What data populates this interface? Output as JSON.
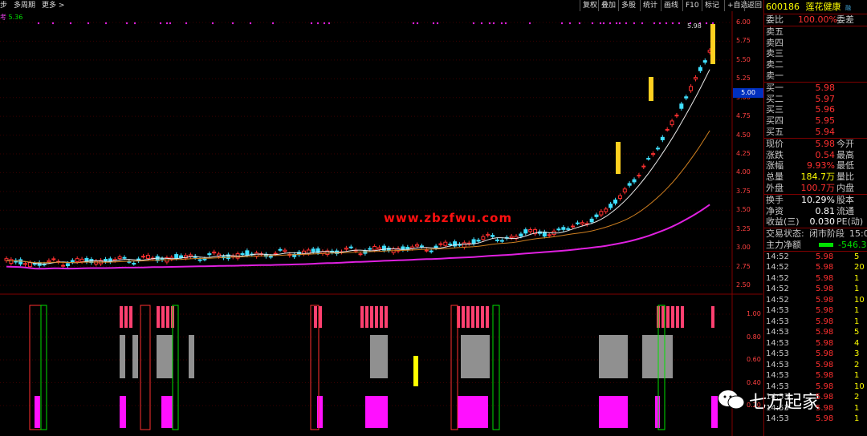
{
  "toolbar": {
    "left_items": [
      "步",
      "多周期",
      "更多 >"
    ],
    "buttons": [
      "复权",
      "叠加",
      "多股",
      "统计",
      "画线",
      "F10",
      "标记",
      "+自选",
      "返回"
    ]
  },
  "indicator": {
    "name": "考",
    "value": "5.36"
  },
  "price_axis": [
    "6.00",
    "5.75",
    "5.50",
    "5.25",
    "5.00",
    "4.75",
    "4.50",
    "4.25",
    "4.00",
    "3.75",
    "3.50",
    "3.25",
    "3.00",
    "2.75",
    "2.50"
  ],
  "current_price_box": "5.00",
  "high_label": "5.98",
  "lower_axis": [
    "1.00",
    "0.80",
    "0.60",
    "0.40",
    "0.20"
  ],
  "watermark": "www.zbzfwu.com",
  "wechat_brand": "七万起家",
  "quote": {
    "code": "600186",
    "name": "莲花健康",
    "tag": "融",
    "weibi_label": "委比",
    "weibi_value": "100.00%",
    "weicha_label": "委差",
    "asks": [
      {
        "label": "卖五"
      },
      {
        "label": "卖四"
      },
      {
        "label": "卖三"
      },
      {
        "label": "卖二"
      },
      {
        "label": "卖一"
      }
    ],
    "bids": [
      {
        "label": "买一",
        "price": "5.98"
      },
      {
        "label": "买二",
        "price": "5.97"
      },
      {
        "label": "买三",
        "price": "5.96"
      },
      {
        "label": "买四",
        "price": "5.95"
      },
      {
        "label": "买五",
        "price": "5.94"
      }
    ],
    "stats": [
      {
        "l1": "现价",
        "v": "5.98",
        "c": "red",
        "l2": "今开"
      },
      {
        "l1": "涨跌",
        "v": "0.54",
        "c": "red",
        "l2": "最高"
      },
      {
        "l1": "涨幅",
        "v": "9.93%",
        "c": "red",
        "l2": "最低"
      },
      {
        "l1": "总量",
        "v": "184.7万",
        "c": "yel",
        "l2": "量比"
      },
      {
        "l1": "外盘",
        "v": "100.7万",
        "c": "red",
        "l2": "内盘"
      }
    ],
    "stats2": [
      {
        "l1": "换手",
        "v": "10.29%",
        "c": "wht",
        "l2": "股本"
      },
      {
        "l1": "净资",
        "v": "0.81",
        "c": "wht",
        "l2": "流通"
      },
      {
        "l1": "收益(三)",
        "v": "0.030",
        "c": "wht",
        "l2": "PE(动)"
      }
    ],
    "trade_status_label": "交易状态:",
    "trade_status_value": "闭市阶段",
    "trade_status_time": "15:00",
    "main_net_label": "主力净额",
    "main_net_value": "-546.3"
  },
  "ticks": [
    {
      "t": "14:52",
      "p": "5.98",
      "v": "5"
    },
    {
      "t": "14:52",
      "p": "5.98",
      "v": "20"
    },
    {
      "t": "14:52",
      "p": "5.98",
      "v": "1"
    },
    {
      "t": "14:52",
      "p": "5.98",
      "v": "1"
    },
    {
      "t": "14:52",
      "p": "5.98",
      "v": "10"
    },
    {
      "t": "14:53",
      "p": "5.98",
      "v": "1"
    },
    {
      "t": "14:53",
      "p": "5.98",
      "v": "1"
    },
    {
      "t": "14:53",
      "p": "5.98",
      "v": "5"
    },
    {
      "t": "14:53",
      "p": "5.98",
      "v": "4"
    },
    {
      "t": "14:53",
      "p": "5.98",
      "v": "3"
    },
    {
      "t": "14:53",
      "p": "5.98",
      "v": "2"
    },
    {
      "t": "14:53",
      "p": "5.98",
      "v": "1"
    },
    {
      "t": "14:53",
      "p": "5.98",
      "v": "10"
    },
    {
      "t": "14:53",
      "p": "5.98",
      "v": "2"
    },
    {
      "t": "14:53",
      "p": "5.98",
      "v": "1"
    },
    {
      "t": "14:53",
      "p": "5.98",
      "v": "1"
    }
  ]
}
